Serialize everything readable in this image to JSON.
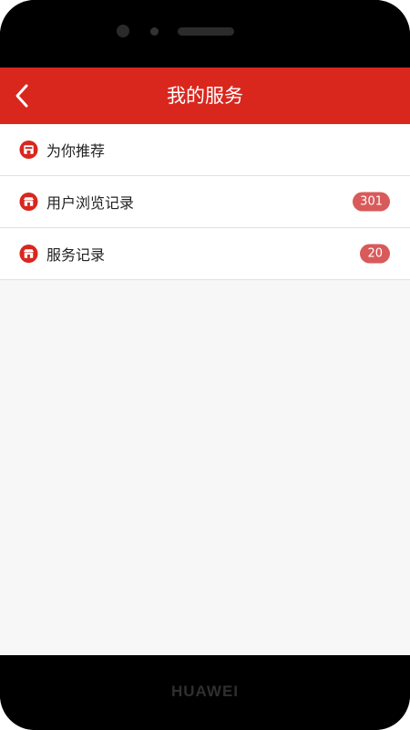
{
  "device": {
    "brand": "HUAWEI"
  },
  "header": {
    "title": "我的服务"
  },
  "list": {
    "items": [
      {
        "label": "为你推荐",
        "badge": ""
      },
      {
        "label": "用户浏览记录",
        "badge": "301"
      },
      {
        "label": "服务记录",
        "badge": "20"
      }
    ]
  },
  "colors": {
    "accent": "#d9271e",
    "badge": "#d95a5a"
  }
}
